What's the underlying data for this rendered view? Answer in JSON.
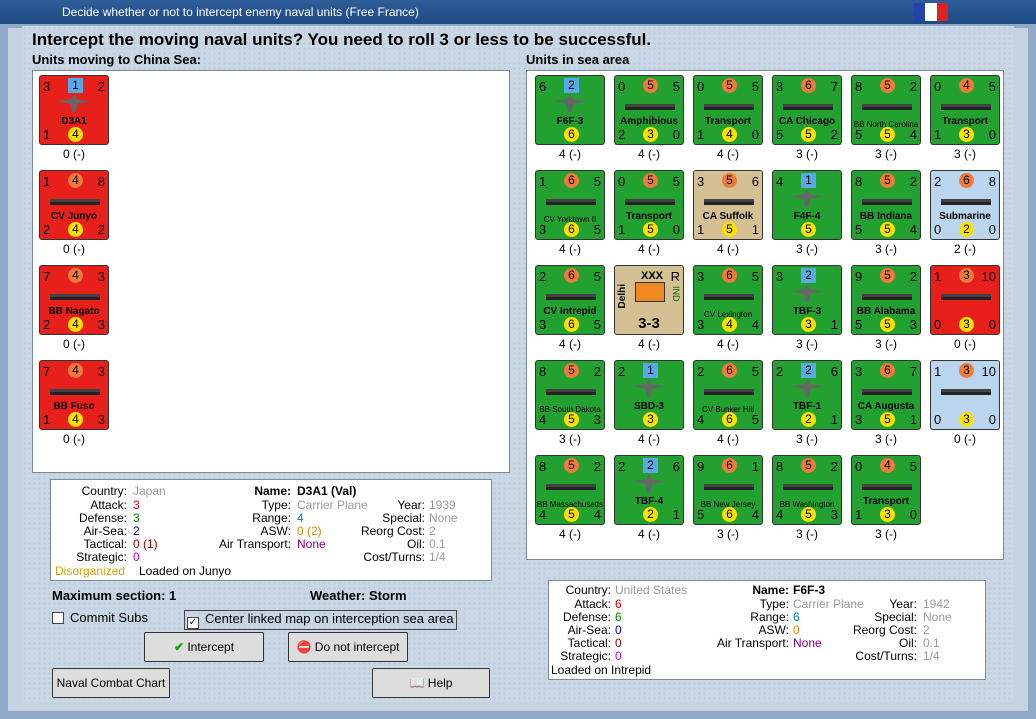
{
  "window": {
    "title": "Decide whether or not to intercept enemy naval units (Free France)"
  },
  "colors": {
    "flag_blue": "#2244aa",
    "flag_white": "#ffffff",
    "flag_red": "#dd2222"
  },
  "heading": "Intercept the moving naval units?  You need to roll 3 or less to be successful.",
  "moving": {
    "label": "Units moving to China Sea:",
    "units": [
      {
        "color": "red",
        "type": "plane",
        "tl": "3",
        "tc": "1",
        "tr": "2",
        "name": "D3A1",
        "bl": "1",
        "bc": "4",
        "br": "",
        "status": "0 (-)"
      },
      {
        "color": "red",
        "type": "ship",
        "tl": "1",
        "tc": "4",
        "tr": "8",
        "name": "CV Junyo",
        "bl": "2",
        "bc": "4",
        "br": "2",
        "status": "0 (-)"
      },
      {
        "color": "red",
        "type": "ship",
        "tl": "7",
        "tc": "4",
        "tr": "3",
        "name": "BB Nagato",
        "bl": "2",
        "bc": "4",
        "br": "3",
        "status": "0 (-)"
      },
      {
        "color": "red",
        "type": "ship",
        "tl": "7",
        "tc": "4",
        "tr": "3",
        "name": "BB Fuso",
        "bl": "1",
        "bc": "4",
        "br": "3",
        "status": "0 (-)"
      }
    ]
  },
  "sea": {
    "label": "Units in sea area",
    "units": [
      {
        "color": "green",
        "type": "plane",
        "tl": "6",
        "tc": "2",
        "tr": "",
        "name": "F6F-3",
        "bl": "",
        "bc": "6",
        "br": "",
        "status": "4 (-)"
      },
      {
        "color": "green",
        "type": "ship",
        "tl": "0",
        "tc": "5",
        "tr": "5",
        "name": "Amphibious",
        "bl": "2",
        "bc": "3",
        "br": "0",
        "status": "4 (-)"
      },
      {
        "color": "green",
        "type": "ship",
        "tl": "0",
        "tc": "5",
        "tr": "5",
        "name": "Transport",
        "bl": "1",
        "bc": "4",
        "br": "0",
        "status": "4 (-)"
      },
      {
        "color": "green",
        "type": "ship",
        "tl": "3",
        "tc": "6",
        "tr": "7",
        "name": "CA Chicago",
        "bl": "5",
        "bc": "5",
        "br": "2",
        "status": "3 (-)"
      },
      {
        "color": "green",
        "type": "ship",
        "tl": "8",
        "tc": "5",
        "tr": "2",
        "name": "BB North Carolina",
        "bl": "5",
        "bc": "5",
        "br": "4",
        "status": "3 (-)"
      },
      {
        "color": "green",
        "type": "ship",
        "tl": "0",
        "tc": "4",
        "tr": "5",
        "name": "Transport",
        "bl": "1",
        "bc": "3",
        "br": "0",
        "status": "3 (-)"
      },
      {
        "color": "green",
        "type": "ship",
        "tl": "1",
        "tc": "6",
        "tr": "5",
        "name": "CV Yorktown II",
        "bl": "3",
        "bc": "6",
        "br": "5",
        "status": "4 (-)"
      },
      {
        "color": "green",
        "type": "ship",
        "tl": "0",
        "tc": "5",
        "tr": "5",
        "name": "Transport",
        "bl": "1",
        "bc": "5",
        "br": "0",
        "status": "4 (-)"
      },
      {
        "color": "tan",
        "type": "ship",
        "tl": "3",
        "tc": "5",
        "tr": "6",
        "name": "CA Suffolk",
        "bl": "1",
        "bc": "5",
        "br": "1",
        "status": "4 (-)"
      },
      {
        "color": "green",
        "type": "plane",
        "tl": "4",
        "tc": "1",
        "tr": "",
        "name": "F4F-4",
        "bl": "",
        "bc": "5",
        "br": "",
        "status": "3 (-)"
      },
      {
        "color": "green",
        "type": "ship",
        "tl": "8",
        "tc": "5",
        "tr": "2",
        "name": "BB Indiana",
        "bl": "5",
        "bc": "5",
        "br": "4",
        "status": "3 (-)"
      },
      {
        "color": "light",
        "type": "ship",
        "tl": "2",
        "tc": "6",
        "tr": "8",
        "name": "Submarine",
        "bl": "0",
        "bc": "2",
        "br": "0",
        "status": "2 (-)"
      },
      {
        "color": "green",
        "type": "ship",
        "tl": "2",
        "tc": "6",
        "tr": "5",
        "name": "CV Intrepid",
        "bl": "3",
        "bc": "6",
        "br": "5",
        "status": "4 (-)"
      },
      {
        "color": "tan",
        "type": "army",
        "tl": "",
        "tc": "",
        "tr": "R",
        "name": "Delhi",
        "bl": "",
        "bc": "",
        "br": "",
        "status": "4 (-)",
        "corps": "XXX",
        "nat": "IND",
        "str": "3-3"
      },
      {
        "color": "green",
        "type": "ship",
        "tl": "3",
        "tc": "6",
        "tr": "5",
        "name": "CV Lexington",
        "bl": "3",
        "bc": "4",
        "br": "4",
        "status": "4 (-)"
      },
      {
        "color": "green",
        "type": "plane",
        "tl": "3",
        "tc": "2",
        "tr": "",
        "name": "TBF-3",
        "bl": "",
        "bc": "3",
        "br": "1",
        "status": "3 (-)"
      },
      {
        "color": "green",
        "type": "ship",
        "tl": "9",
        "tc": "5",
        "tr": "2",
        "name": "BB Alabama",
        "bl": "5",
        "bc": "5",
        "br": "3",
        "status": "3 (-)"
      },
      {
        "color": "red",
        "type": "ship",
        "tl": "1",
        "tc": "3",
        "tr": "10",
        "name": "",
        "bl": "0",
        "bc": "3",
        "br": "0",
        "status": "0 (-)"
      },
      {
        "color": "green",
        "type": "ship",
        "tl": "8",
        "tc": "5",
        "tr": "2",
        "name": "BB South Dakota",
        "bl": "4",
        "bc": "5",
        "br": "3",
        "status": "3 (-)"
      },
      {
        "color": "green",
        "type": "plane",
        "tl": "2",
        "tc": "1",
        "tr": "",
        "name": "SBD-3",
        "bl": "",
        "bc": "3",
        "br": "",
        "status": "4 (-)"
      },
      {
        "color": "green",
        "type": "ship",
        "tl": "2",
        "tc": "6",
        "tr": "5",
        "name": "CV Bunker Hill",
        "bl": "4",
        "bc": "6",
        "br": "5",
        "status": "4 (-)"
      },
      {
        "color": "green",
        "type": "plane",
        "tl": "2",
        "tc": "2",
        "tr": "6",
        "name": "TBF-1",
        "bl": "",
        "bc": "2",
        "br": "1",
        "status": "3 (-)"
      },
      {
        "color": "green",
        "type": "ship",
        "tl": "3",
        "tc": "6",
        "tr": "7",
        "name": "CA Augusta",
        "bl": "3",
        "bc": "5",
        "br": "1",
        "status": "3 (-)"
      },
      {
        "color": "light",
        "type": "ship",
        "tl": "1",
        "tc": "3",
        "tr": "10",
        "name": "",
        "bl": "0",
        "bc": "3",
        "br": "0",
        "status": "0 (-)"
      },
      {
        "color": "green",
        "type": "ship",
        "tl": "8",
        "tc": "5",
        "tr": "2",
        "name": "BB Massachusetts",
        "bl": "4",
        "bc": "5",
        "br": "4",
        "status": "4 (-)"
      },
      {
        "color": "green",
        "type": "plane",
        "tl": "2",
        "tc": "2",
        "tr": "6",
        "name": "TBF-4",
        "bl": "",
        "bc": "2",
        "br": "1",
        "status": "4 (-)"
      },
      {
        "color": "green",
        "type": "ship",
        "tl": "9",
        "tc": "6",
        "tr": "1",
        "name": "BB New Jersey",
        "bl": "5",
        "bc": "6",
        "br": "4",
        "status": "3 (-)"
      },
      {
        "color": "green",
        "type": "ship",
        "tl": "8",
        "tc": "5",
        "tr": "2",
        "name": "BB Washington",
        "bl": "4",
        "bc": "5",
        "br": "3",
        "status": "3 (-)"
      },
      {
        "color": "green",
        "type": "ship",
        "tl": "0",
        "tc": "4",
        "tr": "5",
        "name": "Transport",
        "bl": "1",
        "bc": "3",
        "br": "0",
        "status": "3 (-)"
      }
    ]
  },
  "left_info": {
    "country_l": "Country:",
    "country": "Japan",
    "attack_l": "Attack:",
    "attack": "3",
    "defense_l": "Defense:",
    "defense": "3",
    "airsea_l": "Air-Sea:",
    "airsea": "2",
    "tactical_l": "Tactical:",
    "tactical": "0 (1)",
    "strategic_l": "Strategic:",
    "strategic": "0",
    "name_l": "Name:",
    "name": "D3A1 (Val)",
    "type_l": "Type:",
    "type": "Carrier Plane",
    "year_l": "Year:",
    "year": "1939",
    "range_l": "Range:",
    "range": "4",
    "special_l": "Special:",
    "special": "None",
    "asw_l": "ASW:",
    "asw": "0 (2)",
    "reorg_l": "Reorg Cost:",
    "reorg": "2",
    "airtr_l": "Air Transport:",
    "airtr": "None",
    "oil_l": "Oil:",
    "oil": "0.1",
    "cost_l": "Cost/Turns:",
    "cost": "1/4",
    "disorg": "Disorganized",
    "loaded": "Loaded on Junyo"
  },
  "right_info": {
    "country_l": "Country:",
    "country": "United States",
    "attack_l": "Attack:",
    "attack": "6",
    "defense_l": "Defense:",
    "defense": "6",
    "airsea_l": "Air-Sea:",
    "airsea": "0",
    "tactical_l": "Tactical:",
    "tactical": "0",
    "strategic_l": "Strategic:",
    "strategic": "0",
    "name_l": "Name:",
    "name": "F6F-3",
    "type_l": "Type:",
    "type": "Carrier Plane",
    "year_l": "Year:",
    "year": "1942",
    "range_l": "Range:",
    "range": "6",
    "special_l": "Special:",
    "special": "None",
    "asw_l": "ASW:",
    "asw": "0",
    "reorg_l": "Reorg Cost:",
    "reorg": "2",
    "airtr_l": "Air Transport:",
    "airtr": "None",
    "oil_l": "Oil:",
    "oil": "0.1",
    "cost_l": "Cost/Turns:",
    "cost": "1/4",
    "loaded": "Loaded on Intrepid"
  },
  "maxsection": "Maximum section: 1",
  "weather": "Weather:  Storm",
  "commit_subs": "Commit Subs",
  "center_map": "Center linked map on interception sea area",
  "buttons": {
    "intercept": "Intercept",
    "no_intercept": "Do not intercept",
    "chart": "Naval Combat Chart",
    "help": "Help"
  }
}
